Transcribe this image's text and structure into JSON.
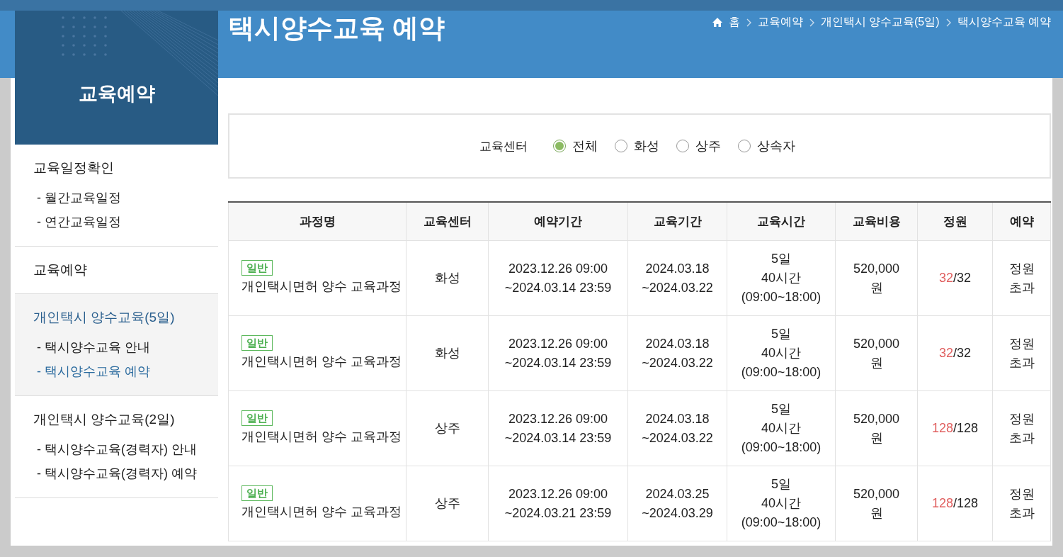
{
  "header": {
    "title": "택시양수교육 예약",
    "breadcrumb": [
      "홈",
      "교육예약",
      "개인택시 양수교육(5일)",
      "택시양수교육 예약"
    ]
  },
  "sidebar": {
    "title": "교육예약",
    "groups": [
      {
        "label": "교육일정확인",
        "selected": false,
        "items": [
          {
            "label": "- 월간교육일정",
            "selected": false
          },
          {
            "label": "- 연간교육일정",
            "selected": false
          }
        ]
      },
      {
        "label": "교육예약",
        "selected": false
      },
      {
        "label": "개인택시 양수교육(5일)",
        "selected": true,
        "items": [
          {
            "label": "- 택시양수교육 안내",
            "selected": false
          },
          {
            "label": "- 택시양수교육 예약",
            "selected": true
          }
        ]
      },
      {
        "label": "개인택시 양수교육(2일)",
        "selected": false,
        "items": [
          {
            "label": "- 택시양수교육(경력자) 안내",
            "selected": false
          },
          {
            "label": "- 택시양수교육(경력자) 예약",
            "selected": false
          }
        ]
      }
    ]
  },
  "filter": {
    "label": "교육센터",
    "options": [
      {
        "label": "전체",
        "selected": true
      },
      {
        "label": "화성",
        "selected": false
      },
      {
        "label": "상주",
        "selected": false
      },
      {
        "label": "상속자",
        "selected": false
      }
    ]
  },
  "table": {
    "columns": [
      "과정명",
      "교육센터",
      "예약기간",
      "교육기간",
      "교육시간",
      "교육비용",
      "정원",
      "예약"
    ],
    "rows": [
      {
        "tag": "일반",
        "course": "개인택시면허 양수 교육과정",
        "center": "화성",
        "reservation_period": "2023.12.26 09:00\n~2024.03.14 23:59",
        "period": "2024.03.18\n~2024.03.22",
        "hours": "5일\n40시간\n(09:00~18:00)",
        "fee": "520,000\n원",
        "enrolled": "32",
        "limit": "/32",
        "status": "정원\n초과"
      },
      {
        "tag": "일반",
        "course": "개인택시면허 양수 교육과정",
        "center": "화성",
        "reservation_period": "2023.12.26 09:00\n~2024.03.14 23:59",
        "period": "2024.03.18\n~2024.03.22",
        "hours": "5일\n40시간\n(09:00~18:00)",
        "fee": "520,000\n원",
        "enrolled": "32",
        "limit": "/32",
        "status": "정원\n초과"
      },
      {
        "tag": "일반",
        "course": "개인택시면허 양수 교육과정",
        "center": "상주",
        "reservation_period": "2023.12.26 09:00\n~2024.03.14 23:59",
        "period": "2024.03.18\n~2024.03.22",
        "hours": "5일\n40시간\n(09:00~18:00)",
        "fee": "520,000\n원",
        "enrolled": "128",
        "limit": "/128",
        "status": "정원\n초과"
      },
      {
        "tag": "일반",
        "course": "개인택시면허 양수 교육과정",
        "center": "상주",
        "reservation_period": "2023.12.26 09:00\n~2024.03.21 23:59",
        "period": "2024.03.25\n~2024.03.29",
        "hours": "5일\n40시간\n(09:00~18:00)",
        "fee": "520,000\n원",
        "enrolled": "128",
        "limit": "/128",
        "status": "정원\n초과"
      }
    ]
  }
}
